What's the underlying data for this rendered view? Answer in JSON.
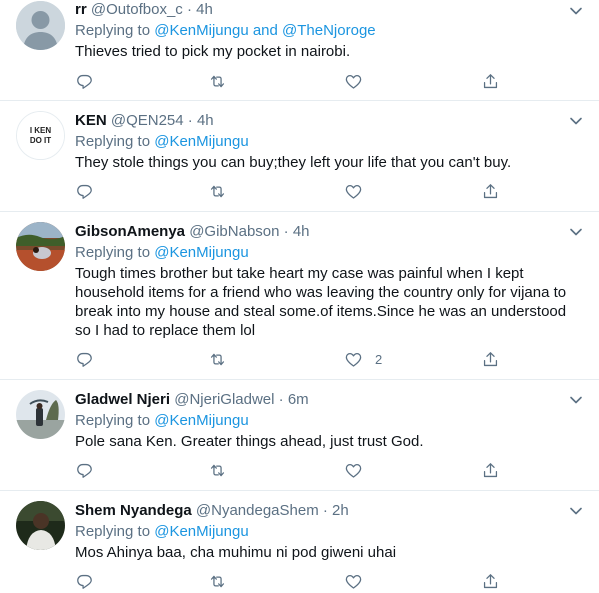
{
  "tweets": [
    {
      "name": "rr",
      "handle": "@Outofbox_c",
      "sep": "·",
      "time": "4h",
      "replying_prefix": "Replying to",
      "mentions": "@KenMijungu and @TheNjoroge",
      "text": "Thieves tried to pick my pocket in nairobi.",
      "likes": "",
      "avatar_icon": "default-avatar-icon"
    },
    {
      "name": "KEN",
      "handle": "@QEN254",
      "sep": "·",
      "time": "4h",
      "replying_prefix": "Replying to",
      "mentions": "@KenMijungu",
      "text": "They stole things you can buy;they left your life that you can't buy.",
      "likes": "",
      "avatar_text": "I KEN DO IT"
    },
    {
      "name": "GibsonAmenya",
      "handle": "@GibNabson",
      "sep": "·",
      "time": "4h",
      "replying_prefix": "Replying to",
      "mentions": "@KenMijungu",
      "text": "Tough times brother but take heart my case was painful when I kept household items for a friend who was leaving the country only for vijana to break into my house and steal some.of items.Since he  was an understood so I had to replace them lol",
      "likes": "2",
      "avatar_icon": "photo-avatar-icon"
    },
    {
      "name": "Gladwel Njeri",
      "handle": "@NjeriGladwel",
      "sep": "·",
      "time": "6m",
      "replying_prefix": "Replying to",
      "mentions": "@KenMijungu",
      "text": "Pole sana Ken. Greater things ahead, just trust God.",
      "likes": "",
      "avatar_icon": "photo-avatar-icon"
    },
    {
      "name": "Shem Nyandega",
      "handle": "@NyandegaShem",
      "sep": "·",
      "time": "2h",
      "replying_prefix": "Replying to",
      "mentions": "@KenMijungu",
      "text": "Mos Ahinya baa, cha muhimu ni pod giweni uhai",
      "likes": "",
      "avatar_icon": "photo-avatar-icon"
    }
  ],
  "icons": {
    "reply": "reply-icon",
    "retweet": "retweet-icon",
    "like": "like-icon",
    "share": "share-icon",
    "more": "chevron-down-icon"
  },
  "colors": {
    "mention": "#1b95e0",
    "secondary_text": "#5b7083",
    "divider": "#e6ecf0"
  }
}
